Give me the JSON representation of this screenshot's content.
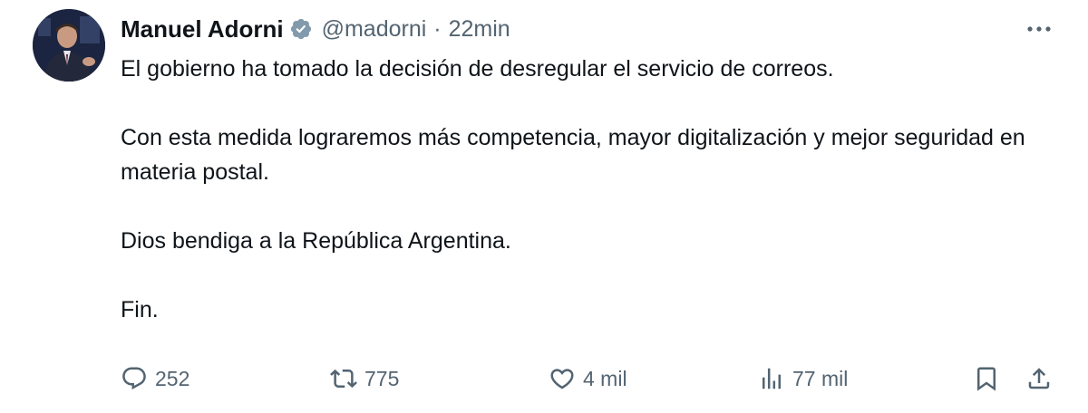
{
  "author": {
    "name": "Manuel Adorni",
    "handle": "@madorni",
    "separator": "·",
    "time": "22min",
    "verified_icon": "verified-badge-icon",
    "verified_color": "#829aab"
  },
  "tweet": {
    "paragraphs": [
      "El gobierno ha tomado la decisión de desregular el servicio de correos.",
      "Con esta medida lograremos más competencia, mayor digitalización y mejor seguridad en materia postal.",
      "Dios bendiga a la República Argentina.",
      "Fin."
    ]
  },
  "actions": {
    "reply": {
      "icon": "reply-icon",
      "count": "252"
    },
    "retweet": {
      "icon": "retweet-icon",
      "count": "775"
    },
    "like": {
      "icon": "heart-icon",
      "count": "4 mil"
    },
    "views": {
      "icon": "views-icon",
      "count": "77 mil"
    },
    "bookmark": {
      "icon": "bookmark-icon"
    },
    "share": {
      "icon": "share-icon"
    }
  },
  "colors": {
    "text": "#0f1419",
    "secondary": "#536471",
    "background": "#ffffff"
  }
}
